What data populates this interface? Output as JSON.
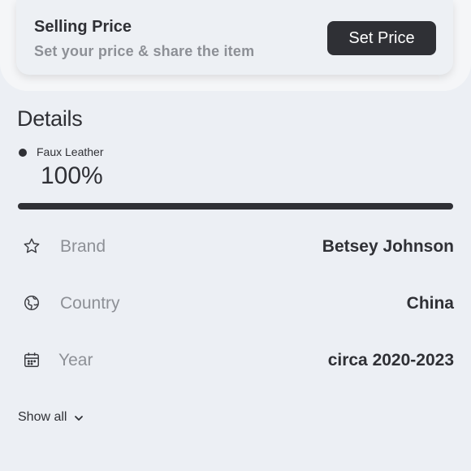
{
  "selling_price": {
    "title": "Selling Price",
    "subtitle": "Set your price & share the item",
    "button_label": "Set Price"
  },
  "details": {
    "heading": "Details",
    "material": {
      "name": "Faux Leather",
      "percent_label": "100%",
      "percent": 100,
      "color": "#2f3035"
    },
    "rows": [
      {
        "icon": "star-icon",
        "label": "Brand",
        "value": "Betsey Johnson"
      },
      {
        "icon": "globe-icon",
        "label": "Country",
        "value": "China"
      },
      {
        "icon": "calendar-icon",
        "label": "Year",
        "value": "circa 2020-2023"
      }
    ],
    "show_all_label": "Show all"
  },
  "colors": {
    "background": "#eceff4",
    "accent_dark": "#2f3035",
    "muted_text": "#8d9096"
  }
}
